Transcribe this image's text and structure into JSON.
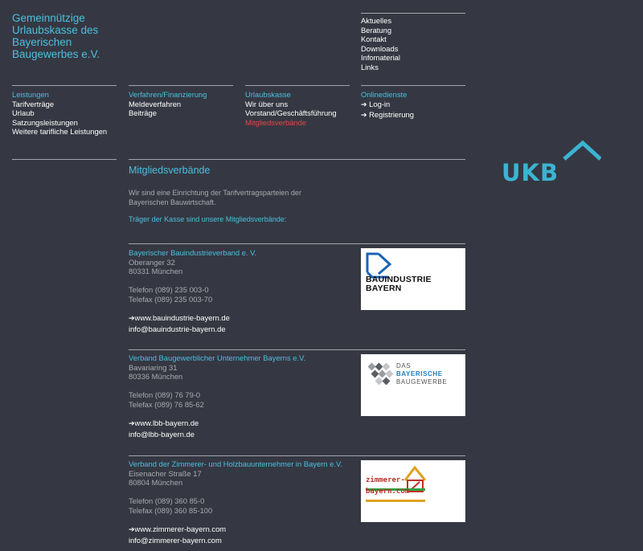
{
  "org": {
    "title_lines": [
      "Gemeinnützige",
      "Urlaubskasse des",
      "Bayerischen",
      "Baugewerbes e.V."
    ]
  },
  "topnav": {
    "items": [
      "Aktuelles",
      "Beratung",
      "Kontakt",
      "Downloads",
      "Infomaterial",
      "Links"
    ]
  },
  "menu": {
    "columns": [
      {
        "heading": "Leistungen",
        "items": [
          "Tarifverträge",
          "Urlaub",
          "Satzungsleistungen",
          "Weitere tarifliche Leistungen"
        ]
      },
      {
        "heading": "Verfahren/Finanzierung",
        "items": [
          "Meldeverfahren",
          "Beiträge"
        ]
      },
      {
        "heading": "Urlaubskasse",
        "items": [
          "Wir über uns",
          "Vorstand/Geschäftsführung",
          "Mitgliedsverbände"
        ],
        "active_index": 2
      },
      {
        "heading": "Onlinedienste",
        "items": [
          "Log-in",
          "Registrierung"
        ]
      }
    ]
  },
  "logo": {
    "text": "UKB",
    "color": "#3bb4d2"
  },
  "content": {
    "title": "Mitgliedsverbände",
    "intro_lines": [
      "Wir sind eine Einrichtung der Tarifvertragsparteien der",
      "Bayerischen Bauwirtschaft."
    ],
    "subtitle": "Träger der Kasse sind unsere Mitgliedsverbände:"
  },
  "members": [
    {
      "name": "Bayerischer Bauindustrieverband e. V.",
      "street": "Oberanger 32",
      "city": "80331 München",
      "phone": "Telefon (089) 235 003-0",
      "fax": "Telefax (089) 235 003-70",
      "web": "www.bauindustrie-bayern.de",
      "email": "info@bauindustrie-bayern.de",
      "logo_lines": [
        "BAUINDUSTRIE",
        "BAYERN"
      ]
    },
    {
      "name": "Verband Baugewerblicher Unternehmer Bayerns e.V.",
      "street": "Bavariaring 31",
      "city": "80336 München",
      "phone": "Telefon (089) 76 79-0",
      "fax": "Telefax (089) 76 85-62",
      "web": "www.lbb-bayern.de",
      "email": "info@lbb-bayern.de",
      "logo_lines": [
        "DAS",
        "BAYERISCHE",
        "BAUGEWERBE"
      ]
    },
    {
      "name": "Verband der Zimmerer- und Holzbauunternehmer in Bayern e.V.",
      "street": "Eisenacher Straße 17",
      "city": "80804 München",
      "phone": "Telefon (089) 360 85-0",
      "fax": "Telefax (089) 360 85-100",
      "web": "www.zimmerer-bayern.com",
      "email": "info@zimmerer-bayern.com",
      "logo_lines": [
        "zimmerer-",
        "bayern.com"
      ]
    }
  ],
  "colors": {
    "background": "#353842",
    "accent": "#4bbfe0",
    "active": "#e34646",
    "muted": "#a8aab0"
  }
}
